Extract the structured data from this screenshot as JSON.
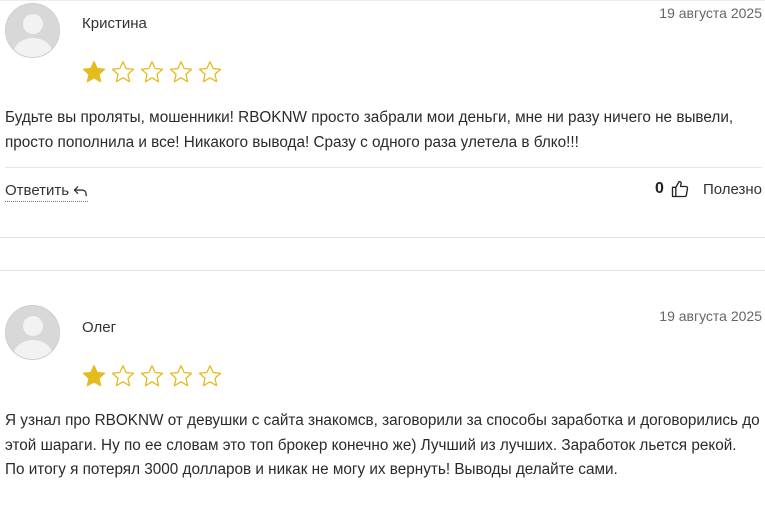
{
  "reviews": [
    {
      "author": "Кристина",
      "date": "19 августа 2025",
      "rating": 1,
      "max_rating": 5,
      "text": "Будьте вы проляты, мошенники! RBOKNW просто забрали мои деньги, мне ни разу ничего не вывели, просто пополнила и все! Никакого вывода! Сразу с одного раза улетела в блко!!!",
      "reply_label": "Ответить",
      "helpful_count": "0",
      "helpful_label": "Полезно"
    },
    {
      "author": "Олег",
      "date": "19 августа 2025",
      "rating": 1,
      "max_rating": 5,
      "text": "Я узнал про RBOKNW от девушки с сайта знакомсв, заговорили за способы заработка и договорились до этой шараги. Ну по ее словам это топ брокер конечно же) Лучший из лучших. Заработок льется рекой. По итогу я потерял 3000 долларов и никак не могу их вернуть! Выводы делайте сами."
    }
  ],
  "colors": {
    "star_filled": "#e3bc1e",
    "star_empty_outline": "#e3bc1e",
    "divider": "#e3e3e3"
  },
  "icons": {
    "star": "star-icon",
    "reply": "reply-arrow-icon",
    "helpful": "thumbs-up-icon",
    "avatar": "user-avatar-placeholder"
  }
}
